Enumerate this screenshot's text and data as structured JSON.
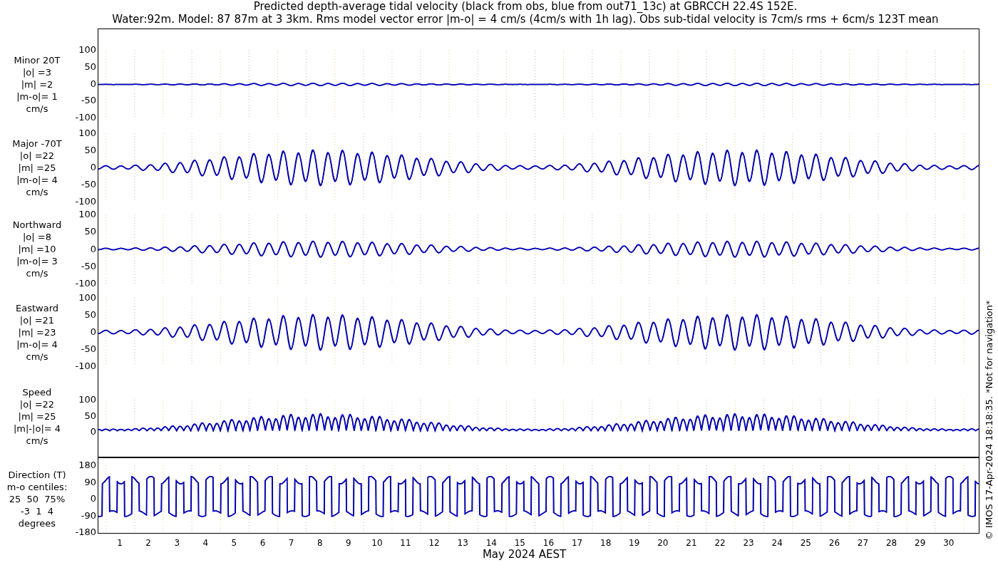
{
  "title_lines": [
    "Predicted depth-average tidal velocity (black from obs, blue from out71_13c) at GBRCCH 22.4S 152E.",
    "Water:92m. Model: 87 87m at 3 3km. Rms model vector error |m-o| = 4 cm/s (4cm/s with 1h lag). Obs sub-tidal velocity is 7cm/s rms + 6cm/s 123T mean"
  ],
  "panels": [
    {
      "kind": "minor",
      "label_lines": [
        "Minor 20T",
        "|o| =3",
        "|m| =2",
        "|m-o|= 1",
        "cm/s"
      ],
      "yticks": [
        "100",
        "50",
        "0",
        "-50",
        "-100"
      ]
    },
    {
      "kind": "major",
      "label_lines": [
        "Major -70T",
        "|o| =22",
        "|m| =25",
        "|m-o|= 4",
        "cm/s"
      ],
      "yticks": [
        "100",
        "50",
        "0",
        "-50",
        "-100"
      ]
    },
    {
      "kind": "northward",
      "label_lines": [
        "Northward",
        "|o| =8",
        "|m| =10",
        "|m-o|= 3",
        "cm/s"
      ],
      "yticks": [
        "100",
        "50",
        "0",
        "-50",
        "-100"
      ]
    },
    {
      "kind": "eastward",
      "label_lines": [
        "Eastward",
        "|o| =21",
        "|m| =23",
        "|m-o|= 4",
        "cm/s"
      ],
      "yticks": [
        "100",
        "50",
        "0",
        "-50",
        "-100"
      ]
    },
    {
      "kind": "speed",
      "label_lines": [
        "Speed",
        "|o| =22",
        "|m| =25",
        "|m|-|o|= 4",
        "cm/s"
      ],
      "yticks": [
        "100",
        "50",
        "0"
      ]
    },
    {
      "kind": "direction",
      "label_lines": [
        "Direction (T)",
        "m-o centiles:",
        "25  50  75%",
        "-3  1  4",
        "degrees"
      ],
      "yticks": [
        "180",
        "90",
        "0",
        "-90",
        "-180"
      ]
    }
  ],
  "x_axis": {
    "ticks": [
      "1",
      "2",
      "3",
      "4",
      "5",
      "6",
      "7",
      "8",
      "9",
      "10",
      "11",
      "12",
      "13",
      "14",
      "15",
      "16",
      "17",
      "18",
      "19",
      "20",
      "21",
      "22",
      "23",
      "24",
      "25",
      "26",
      "27",
      "28",
      "29",
      "30"
    ],
    "label": "May 2024 AEST"
  },
  "side_note": "© IMOS 17-Apr-2024 18:18:35. *Not for navigation*"
}
